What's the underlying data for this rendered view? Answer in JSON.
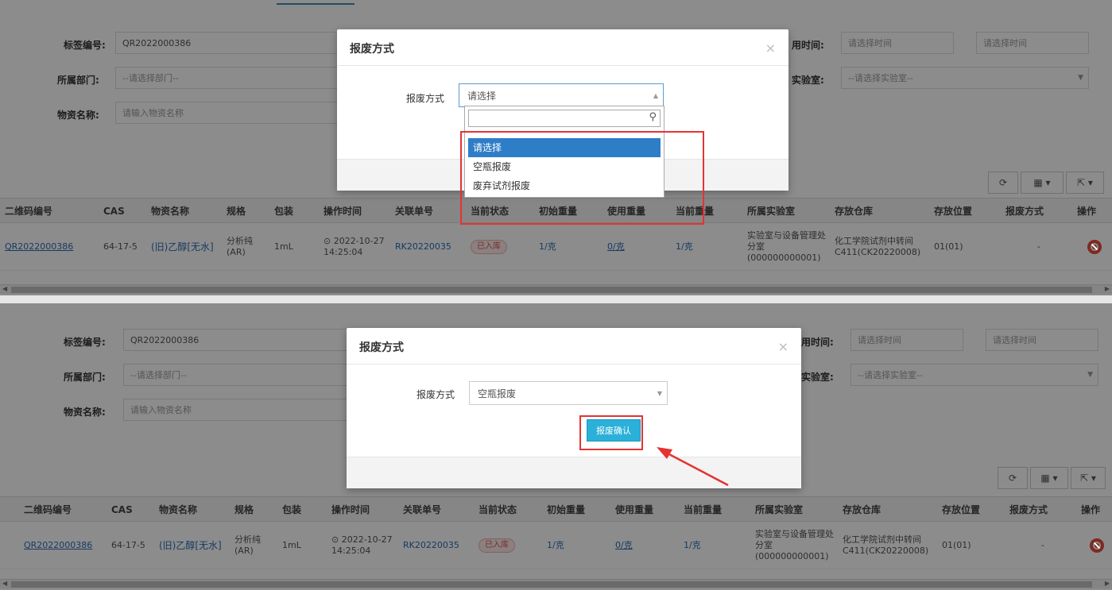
{
  "form": {
    "label_tag": "标签编号:",
    "tag_value": "QR2022000386",
    "label_dept": "所属部门:",
    "dept_placeholder": "--请选择部门--",
    "label_material": "物资名称:",
    "material_placeholder": "请输入物资名称",
    "label_time": "用时间:",
    "time_placeholder_1": "请选择时间",
    "time_placeholder_2": "请选择时间",
    "label_lab": "实验室:",
    "lab_placeholder": "--请选择实验室--"
  },
  "modal": {
    "title": "报废方式",
    "close": "×",
    "field_label": "报废方式",
    "select_placeholder": "请选择",
    "select_value": "空瓶报废",
    "confirm_button": "报废确认"
  },
  "dropdown": {
    "options": [
      "请选择",
      "空瓶报废",
      "废弃试剂报废"
    ],
    "selected_index": 0
  },
  "toolbar": {
    "refresh_icon": "refresh-icon",
    "columns_icon": "columns-icon",
    "export_icon": "export-icon"
  },
  "table": {
    "columns": [
      "二维码编号",
      "CAS",
      "物资名称",
      "规格",
      "包装",
      "操作时间",
      "关联单号",
      "当前状态",
      "初始重量",
      "使用重量",
      "当前重量",
      "所属实验室",
      "存放仓库",
      "存放位置",
      "报废方式",
      "操作"
    ],
    "row": {
      "qr": "QR2022000386",
      "cas": "64-17-5",
      "name": "(旧)乙醇[无水]",
      "spec": "分析纯(AR)",
      "pack": "1mL",
      "time": "⊙ 2022-10-27 14:25:04",
      "order": "RK20220035",
      "status": "已入库",
      "init_weight": "1/克",
      "used_weight": "0/克",
      "cur_weight": "1/克",
      "lab": "实验室与设备管理处分室(000000000001)",
      "warehouse": "化工学院试剂中转间C411(CK20220008)",
      "position": "01(01)",
      "scrap_method": "-"
    }
  },
  "colors": {
    "accent": "#2e7dc7",
    "highlight_box": "#e53333",
    "confirm_button": "#2ab0d9",
    "link": "#2a6cb3"
  }
}
